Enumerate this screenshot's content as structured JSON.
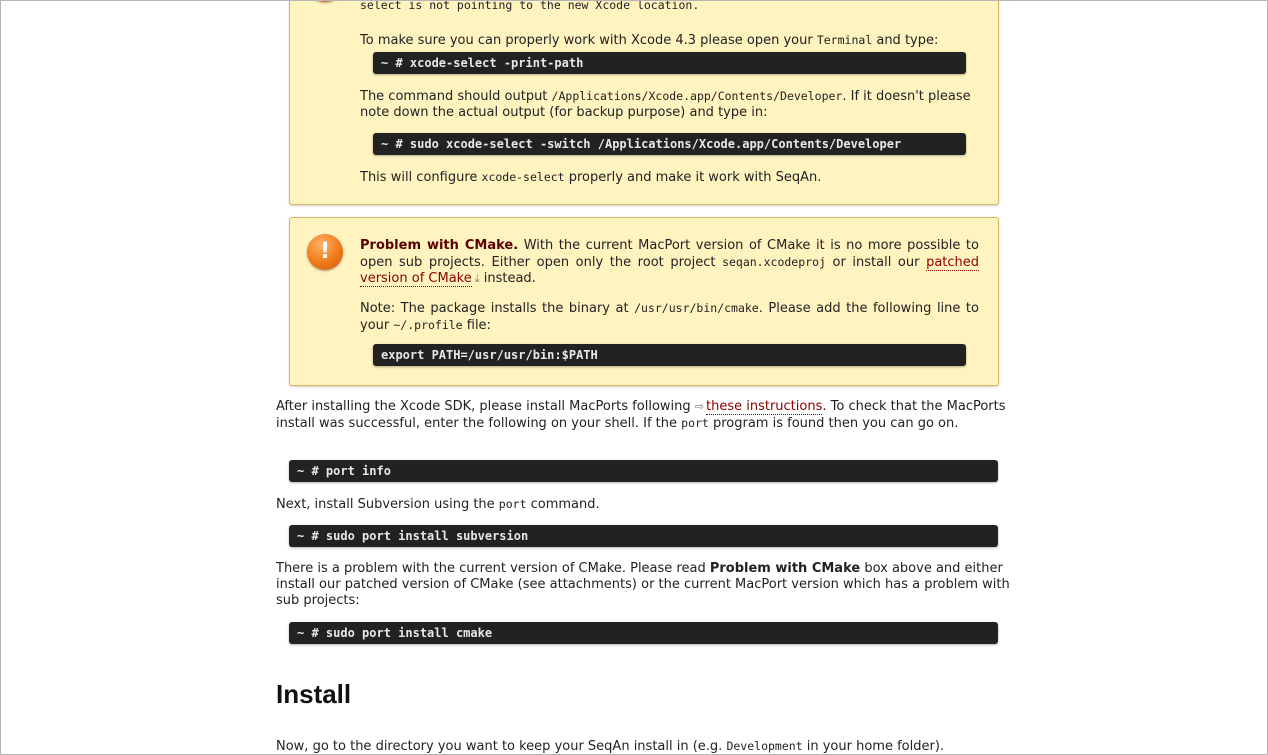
{
  "note_xcode": {
    "clipped_top": "select is not pointing to the new Xcode location.",
    "p1_pre": "To make sure you can properly work with Xcode 4.3 please open your ",
    "p1_code": "Terminal",
    "p1_post": " and type:",
    "cmd1": "~ # xcode-select -print-path",
    "p2_pre": "The command should output ",
    "p2_code": "/Applications/Xcode.app/Contents/Developer",
    "p2_post": ". If it doesn't please note down the actual output (for backup purpose) and type in:",
    "cmd2": "~ # sudo xcode-select -switch /Applications/Xcode.app/Contents/Developer",
    "p3_pre": "This will configure ",
    "p3_code": "xcode-select",
    "p3_post": " properly and make it work with SeqAn."
  },
  "note_cmake": {
    "icon": "!",
    "title": "Problem with CMake.",
    "p1_a": " With the current MacPort version of CMake it is no more possible to open sub projects. Either open only the root project ",
    "p1_code": "seqan.xcodeproj",
    "p1_b": " or install our ",
    "p1_link": "patched version of CMake",
    "p1_c": " instead.",
    "p2_a": "Note: The package installs the binary at ",
    "p2_code1": "/usr/usr/bin/cmake",
    "p2_b": ". Please add the following line to your ",
    "p2_code2": "~/.profile",
    "p2_c": " file:",
    "cmd": "export PATH=/usr/usr/bin:$PATH"
  },
  "body": {
    "para1_a": "After installing the Xcode SDK, please install MacPorts following ",
    "para1_link": "these instructions",
    "para1_b": ". To check that the MacPorts install was successful, enter the following on your shell. If the ",
    "para1_code": "port",
    "para1_c": " program is found then you can go on.",
    "cmd_port_info": "~ # port info",
    "para2_a": "Next, install Subversion using the ",
    "para2_code": "port",
    "para2_b": " command.",
    "cmd_svn": "~ # sudo port install subversion",
    "para3_a": "There is a problem with the current version of CMake. Please read ",
    "para3_bold": "Problem with CMake",
    "para3_b": " box above and either install our patched version of CMake (see attachments) or the current MacPort version which has a problem with sub projects:",
    "cmd_cmake": "~ # sudo port install cmake",
    "install_heading": "Install",
    "para4_a": "Now, go to the directory you want to keep your SeqAn install in (e.g. ",
    "para4_code": "Development",
    "para4_b": " in your home folder)."
  }
}
